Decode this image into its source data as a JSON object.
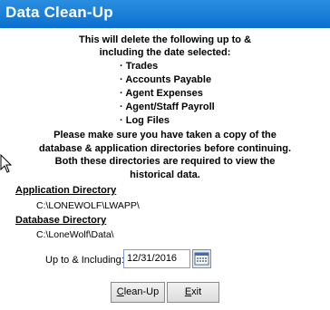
{
  "window": {
    "title": "Data Clean-Up"
  },
  "intro": {
    "line1": "This will delete the following up to &",
    "line2": "including the date selected:"
  },
  "items": [
    "Trades",
    "Accounts Payable",
    "Agent Expenses",
    "Agent/Staff Payroll",
    "Log Files"
  ],
  "warning": {
    "line1": "Please make sure you have taken a copy of the",
    "line2": "database & application directories before continuing.",
    "line3": "Both these directories are required to view the",
    "line4": "historical data."
  },
  "application_directory": {
    "label": "Application Directory",
    "path": "C:\\LONEWOLF\\LWAPP\\"
  },
  "database_directory": {
    "label": "Database Directory",
    "path": "C:\\LoneWolf\\Data\\"
  },
  "date": {
    "label": "Up to & Including:",
    "value": "12/31/2016"
  },
  "buttons": {
    "cleanup": {
      "mnemonic": "C",
      "rest": "lean-Up"
    },
    "exit": {
      "mnemonic": "E",
      "rest": "xit"
    }
  },
  "colors": {
    "titlebar": "#0a6fd0",
    "title_text": "#ffffff"
  },
  "icons": {
    "calendar": "calendar-icon",
    "cursor": "mouse-cursor-icon"
  }
}
